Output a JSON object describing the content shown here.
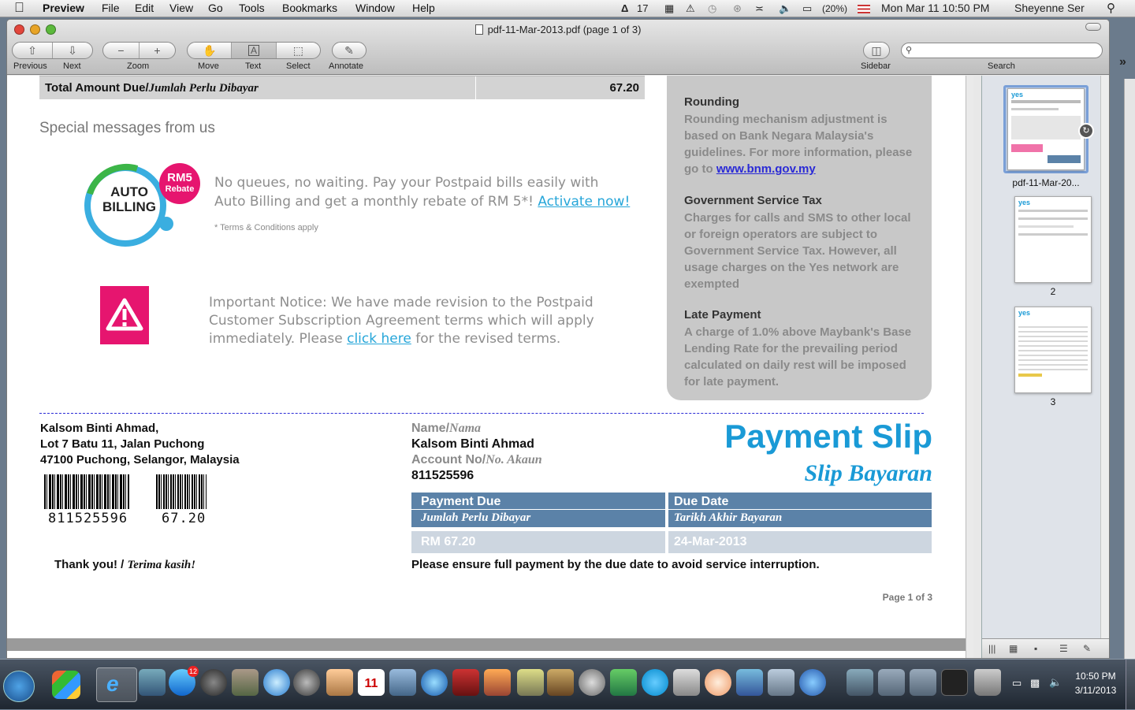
{
  "menubar": {
    "app_name": "Preview",
    "items": [
      "File",
      "Edit",
      "View",
      "Go",
      "Tools",
      "Bookmarks",
      "Window",
      "Help"
    ],
    "adobe_count": "17",
    "battery": "(20%)",
    "clock": "Mon Mar 11  10:50 PM",
    "user": "Sheyenne Ser"
  },
  "window": {
    "title": "pdf-11-Mar-2013.pdf (page 1 of 3)"
  },
  "toolbar": {
    "previous": "Previous",
    "next": "Next",
    "zoom": "Zoom",
    "move": "Move",
    "text": "Text",
    "select": "Select",
    "annotate": "Annotate",
    "sidebar": "Sidebar",
    "search": "Search",
    "search_value": ""
  },
  "doc": {
    "total_label": "Total Amount Due/",
    "total_label_malay": "Jumlah Perlu Dibayar",
    "total_value": "67.20",
    "special_heading": "Special messages from us",
    "auto_billing_badge_top": "RM5",
    "auto_billing_badge_bottom": "Rebate",
    "auto_billing_logo_1": "AUTO",
    "auto_billing_logo_2": "BILLING",
    "promo_line1": "No queues, no waiting. Pay your Postpaid bills easily with",
    "promo_line2": "Auto Billing and get a monthly rebate of RM 5*!",
    "promo_link": "Activate now!",
    "promo_terms": "* Terms & Conditions apply",
    "notice_line1": "Important Notice: We have made revision to the Postpaid",
    "notice_line2": "Customer Subscription Agreement terms which will apply",
    "notice_line3_a": "immediately. Please",
    "notice_link": "click here",
    "notice_line3_b": "for the revised terms.",
    "rounding_title": "Rounding",
    "rounding_text": "Rounding mechanism adjustment is based on Bank Negara Malaysia's guidelines. For more information, please go to",
    "rounding_link": "www.bnm.gov.my",
    "gst_title": "Government Service Tax",
    "gst_text": "Charges for calls and SMS to other local or foreign operators are subject to Government Service Tax. However, all usage charges on the Yes network are exempted",
    "late_title": "Late Payment",
    "late_text": "A charge of 1.0% above Maybank's Base Lending Rate for the prevailing period calculated on daily rest will be imposed for late payment.",
    "address_1": "Kalsom Binti Ahmad,",
    "address_2": "Lot 7 Batu 11, Jalan Puchong",
    "address_3": "47100  Puchong, Selangor, Malaysia",
    "barcode_1_text": "811525596",
    "barcode_2_text": "67.20",
    "thanks": "Thank you! / ",
    "thanks_malay": "Terima kasih!",
    "name_label": "Name/",
    "name_label_malay": "Nama",
    "name_value": "Kalsom Binti Ahmad",
    "account_label": "Account No/",
    "account_label_malay": "No. Akaun",
    "account_value": "811525596",
    "slip_title": "Payment Slip",
    "slip_title_malay": "Slip Bayaran",
    "payment_due_label": "Payment Due",
    "payment_due_label_malay": "Jumlah Perlu Dibayar",
    "due_date_label": "Due Date",
    "due_date_label_malay": "Tarikh Akhir Bayaran",
    "payment_due_value": "RM 67.20",
    "due_date_value": "24-Mar-2013",
    "ensure_note": "Please ensure full payment by the due date to avoid service interruption.",
    "page_indicator": "Page 1 of 3"
  },
  "sidebar": {
    "thumbs": [
      "pdf-11-Mar-20...",
      "2",
      "3"
    ],
    "thumb_brand": "yes"
  },
  "taskbar": {
    "badge_count": "12",
    "calendar_day": "11",
    "clock_time": "10:50 PM",
    "clock_date": "3/11/2013"
  },
  "colors": {
    "accent_blue": "#1a9ad6",
    "slip_header": "#5b82a8",
    "pink": "#e6156f",
    "auto_billing_ring": "#3aaee0",
    "auto_billing_green": "#3cb548"
  }
}
